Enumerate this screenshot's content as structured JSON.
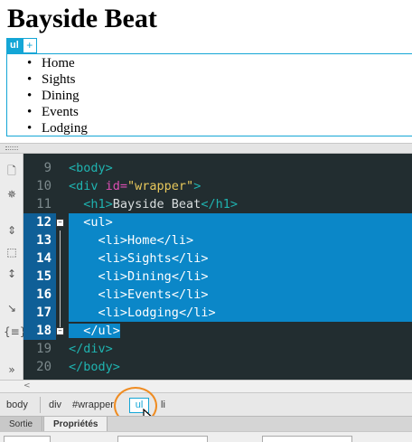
{
  "live_view": {
    "heading": "Bayside Beat",
    "element_tag": "ul",
    "add_button": "+",
    "list_items": [
      "Home",
      "Sights",
      "Dining",
      "Events",
      "Lodging"
    ]
  },
  "code": {
    "line_numbers": [
      "9",
      "10",
      "11",
      "12",
      "13",
      "14",
      "15",
      "16",
      "17",
      "18",
      "19",
      "20"
    ],
    "selected_lines": [
      "12",
      "13",
      "14",
      "15",
      "16",
      "17",
      "18"
    ],
    "lines": [
      {
        "indent": "",
        "parts": [
          {
            "c": "tag",
            "t": "<body>"
          }
        ]
      },
      {
        "indent": "",
        "parts": [
          {
            "c": "tag",
            "t": "<div "
          },
          {
            "c": "attr",
            "t": "id="
          },
          {
            "c": "str",
            "t": "\"wrapper\""
          },
          {
            "c": "tag",
            "t": ">"
          }
        ]
      },
      {
        "indent": "  ",
        "parts": [
          {
            "c": "tag",
            "t": "<h1>"
          },
          {
            "c": "txt",
            "t": "Bayside Beat"
          },
          {
            "c": "tag",
            "t": "</h1>"
          }
        ]
      },
      {
        "indent": "  ",
        "parts": [
          {
            "c": "tag",
            "t": "<ul>"
          }
        ]
      },
      {
        "indent": "    ",
        "parts": [
          {
            "c": "tag",
            "t": "<li>"
          },
          {
            "c": "txt",
            "t": "Home"
          },
          {
            "c": "tag",
            "t": "</li>"
          }
        ]
      },
      {
        "indent": "    ",
        "parts": [
          {
            "c": "tag",
            "t": "<li>"
          },
          {
            "c": "txt",
            "t": "Sights"
          },
          {
            "c": "tag",
            "t": "</li>"
          }
        ]
      },
      {
        "indent": "    ",
        "parts": [
          {
            "c": "tag",
            "t": "<li>"
          },
          {
            "c": "txt",
            "t": "Dining"
          },
          {
            "c": "tag",
            "t": "</li>"
          }
        ]
      },
      {
        "indent": "    ",
        "parts": [
          {
            "c": "tag",
            "t": "<li>"
          },
          {
            "c": "txt",
            "t": "Events"
          },
          {
            "c": "tag",
            "t": "</li>"
          }
        ]
      },
      {
        "indent": "    ",
        "parts": [
          {
            "c": "tag",
            "t": "<li>"
          },
          {
            "c": "txt",
            "t": "Lodging"
          },
          {
            "c": "tag",
            "t": "</li>"
          }
        ]
      },
      {
        "indent": "  ",
        "parts": [
          {
            "c": "tag",
            "t": "</ul>"
          }
        ]
      },
      {
        "indent": "",
        "parts": [
          {
            "c": "tag",
            "t": "</div>"
          }
        ]
      },
      {
        "indent": "",
        "parts": [
          {
            "c": "tag",
            "t": "</body>"
          }
        ]
      }
    ],
    "colors": {
      "tag": "#1fb3b0",
      "attr": "#dd4eb3",
      "string": "#e8c85b",
      "selection": "#0b87c8",
      "background": "#222d30"
    }
  },
  "toolbar_icons": [
    "open-documents-icon",
    "collapse-icon",
    "expand-all-icon",
    "select-parent-icon",
    "balance-braces-icon",
    "line-numbers-icon",
    "apply-comment-icon",
    "format-icon",
    "more-icon"
  ],
  "tag_selector": {
    "crumbs": [
      "body",
      "div",
      "#wrapper",
      "ul",
      "li"
    ],
    "active_crumb": "ul",
    "highlight_color": "#ef8c22"
  },
  "panel_tabs": {
    "output": "Sortie",
    "properties": "Propriétés"
  }
}
